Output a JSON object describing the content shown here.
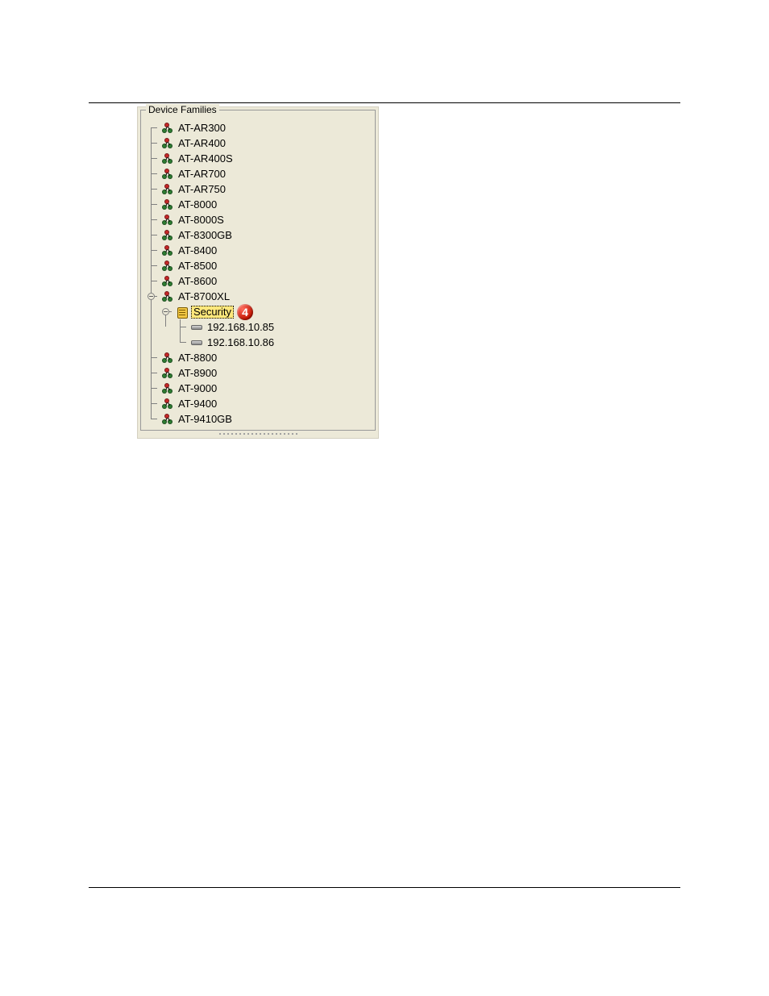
{
  "panel": {
    "title": "Device Families",
    "families": [
      "AT-AR300",
      "AT-AR400",
      "AT-AR400S",
      "AT-AR700",
      "AT-AR750",
      "AT-8000",
      "AT-8000S",
      "AT-8300GB",
      "AT-8400",
      "AT-8500",
      "AT-8600",
      "AT-8800",
      "AT-8900",
      "AT-9000",
      "AT-9400",
      "AT-9410GB"
    ],
    "expanded": {
      "family": "AT-8700XL",
      "config": {
        "label": "Security",
        "selected": true,
        "callout": "4",
        "hosts": [
          "192.168.10.85",
          "192.168.10.86"
        ]
      }
    }
  }
}
